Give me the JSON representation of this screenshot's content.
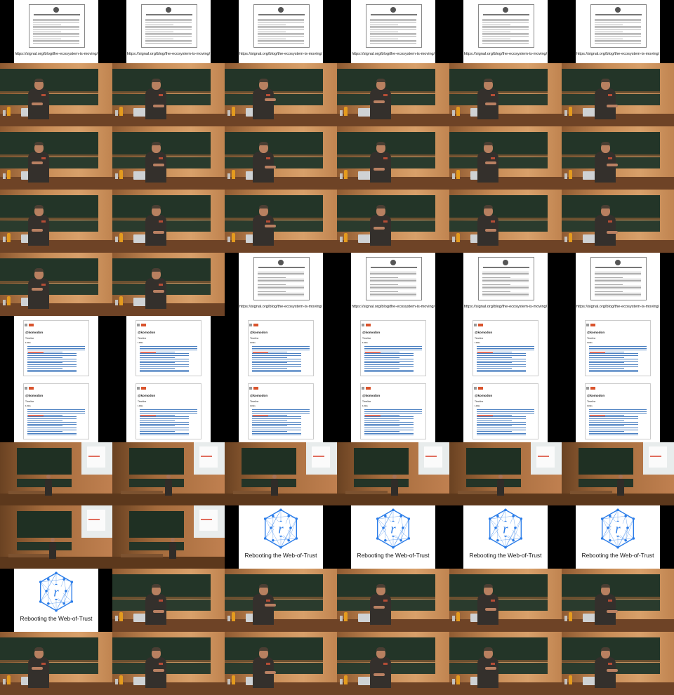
{
  "video_contact_sheet": {
    "columns": 6,
    "rows": 11,
    "blog_slide": {
      "url_text": "https://signal.org/blog/the-ecosystem-is-moving/",
      "document_title_visible": false
    },
    "mastodon_slide": {
      "heading": "@komodon",
      "subheading": "Timeline",
      "section": "Links"
    },
    "logo_slide": {
      "caption": "Rebooting the Web-of-Trust",
      "logo_letter": "r",
      "logo_color": "#2b7de9"
    },
    "tile_types": [
      "blog",
      "blog",
      "blog",
      "blog",
      "blog",
      "blog",
      "speaker",
      "speaker",
      "speaker",
      "speaker",
      "speaker",
      "speaker",
      "speaker",
      "speaker",
      "speaker",
      "speaker",
      "speaker",
      "speaker",
      "speaker",
      "speaker",
      "speaker",
      "speaker",
      "speaker",
      "speaker",
      "speaker",
      "speaker",
      "blog",
      "blog",
      "blog",
      "blog",
      "mastodon",
      "mastodon",
      "mastodon",
      "mastodon",
      "mastodon",
      "mastodon",
      "mastodon",
      "mastodon",
      "mastodon",
      "mastodon",
      "mastodon",
      "mastodon",
      "wide",
      "wide",
      "wide",
      "wide",
      "wide",
      "wide",
      "wide",
      "wide",
      "logo",
      "logo",
      "logo",
      "logo",
      "logo",
      "speaker",
      "speaker",
      "speaker",
      "speaker",
      "speaker",
      "speaker",
      "speaker",
      "speaker",
      "speaker",
      "speaker",
      "speaker"
    ]
  }
}
